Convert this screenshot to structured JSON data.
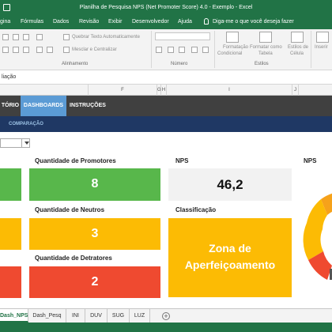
{
  "window": {
    "title": "Planilha de Pesquisa NPS (Net Promoter Score) 4.0 - Exemplo  -  Excel"
  },
  "menu": {
    "tabs": [
      "gina",
      "Fórmulas",
      "Dados",
      "Revisão",
      "Exibir",
      "Desenvolvedor",
      "Ajuda"
    ],
    "tell_me": "Diga-me o que você deseja fazer"
  },
  "ribbon": {
    "wrap_text": "Quebrar Texto Automaticamente",
    "merge_center": "Mesclar e Centralizar",
    "group_alignment": "Alinhamento",
    "group_number": "Número",
    "group_styles": "Estilos",
    "conditional_formatting": [
      "Formatação",
      "Condicional"
    ],
    "format_as_table": [
      "Formatar como",
      "Tabela"
    ],
    "cell_styles": [
      "Estilos de",
      "Célula"
    ],
    "insert": "Inserir"
  },
  "formula_bar": {
    "content": "liação"
  },
  "columns": [
    "F",
    "G",
    "H",
    "I",
    "J"
  ],
  "dashboard": {
    "nav_tabs": [
      "TÓRIO",
      "DASHBOARDS",
      "INSTRUÇÕES"
    ],
    "active_tab": "DASHBOARDS",
    "sub_tab": "COMPARAÇÃO",
    "promoters_label": "Quantidade de Promotores",
    "promoters_value": "8",
    "neutrals_label": "Quantidade de Neutros",
    "neutrals_value": "3",
    "detractors_label": "Quantidade de Detratores",
    "detractors_value": "2",
    "nps_label": "NPS",
    "nps_value": "46,2",
    "classification_label": "Classificação",
    "classification_value": [
      "Zona de",
      "Aperfeiçoamento"
    ],
    "gauge_label": "NPS"
  },
  "sheet_tabs": [
    "Dash_NPS",
    "Dash_Pesq",
    "INI",
    "DUV",
    "SUG",
    "LUZ"
  ],
  "colors": {
    "excel_green": "#217346",
    "nav_dark": "#404040",
    "nav_active": "#5b9bd5",
    "subnav": "#1f3864",
    "promoter_green": "#58b74b",
    "neutral_yellow": "#fcbb04",
    "detractor_red": "#ef4a30"
  }
}
